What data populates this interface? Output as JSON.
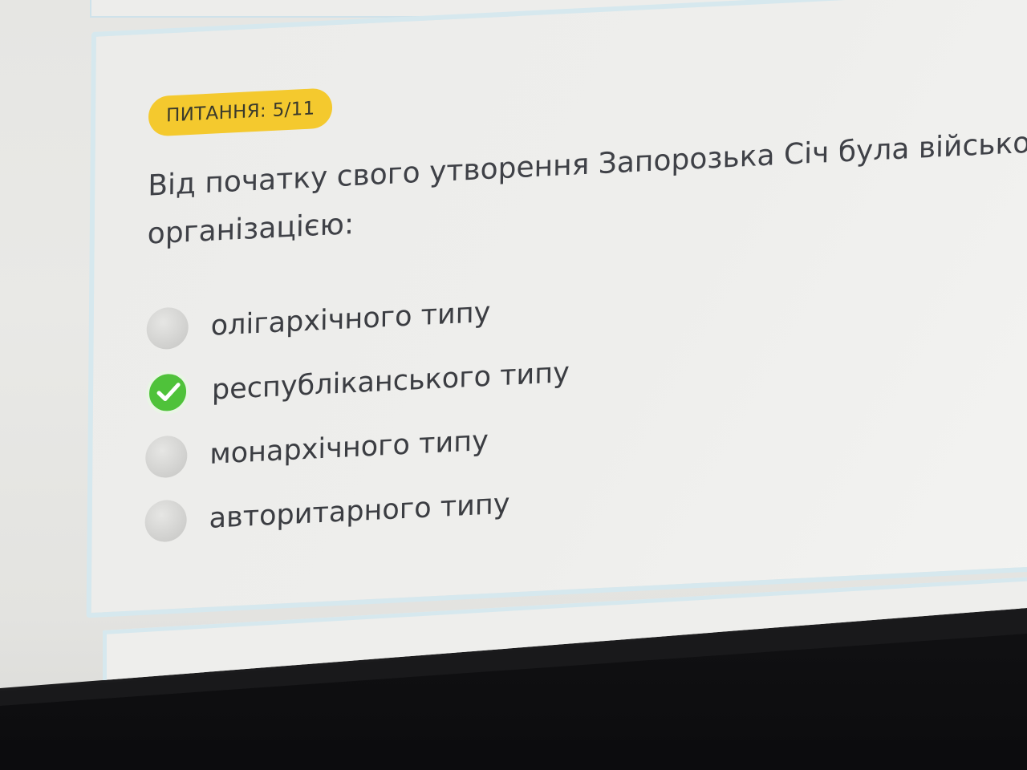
{
  "quiz": {
    "badge": "ПИТАННЯ: 5/11",
    "question_line1": "Від початку свого утворення Запорозька Січ була військово-пол",
    "question_line2": "організацією:",
    "options": [
      {
        "label": "олігархічного типу",
        "selected": false
      },
      {
        "label": "республіканського типу",
        "selected": true
      },
      {
        "label": "монархічного типу",
        "selected": false
      },
      {
        "label": "авторитарного типу",
        "selected": false
      }
    ],
    "colors": {
      "badge": "#f4c92e",
      "selected": "#4fc23a",
      "card_border": "#d6e8ee"
    }
  }
}
